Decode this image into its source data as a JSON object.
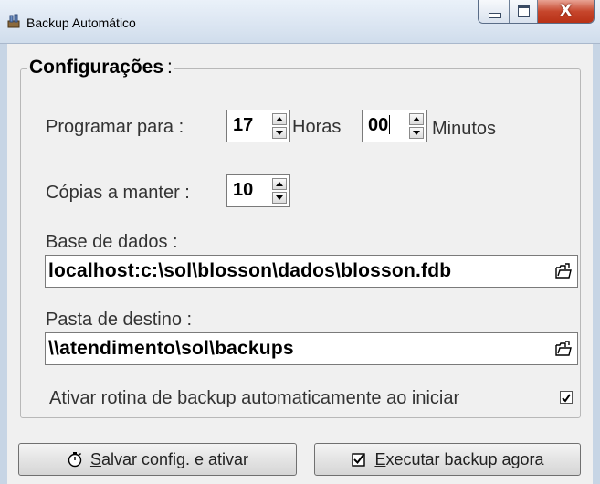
{
  "window": {
    "title": "Backup Automático",
    "close_glyph": "X",
    "icons": [
      "app-icon",
      "minimize-icon",
      "maximize-icon",
      "close-icon"
    ]
  },
  "group": {
    "legend": "Configurações",
    "legend_suffix": ":"
  },
  "schedule": {
    "label": "Programar para :",
    "hours_value": "17",
    "hours_label": "Horas",
    "minutes_value": "00",
    "minutes_label": "Minutos"
  },
  "copies": {
    "label": "Cópias a manter :",
    "value": "10"
  },
  "database": {
    "label": "Base de dados :",
    "value": "localhost:c:\\sol\\blosson\\dados\\blosson.fdb"
  },
  "destination": {
    "label": "Pasta de destino :",
    "value": "\\\\atendimento\\sol\\backups"
  },
  "autostart": {
    "label": "Ativar rotina de backup automaticamente ao iniciar",
    "checked": true
  },
  "buttons": {
    "save": {
      "hotkey": "S",
      "rest": "alvar config. e ativar",
      "icon": "stopwatch-icon"
    },
    "run": {
      "hotkey": "E",
      "rest": "xecutar backup agora",
      "icon": "checkbox-icon"
    }
  },
  "colors": {
    "titlebar": "#dce6f2",
    "close_button": "#c6462c",
    "background": "#f0f0f0"
  }
}
